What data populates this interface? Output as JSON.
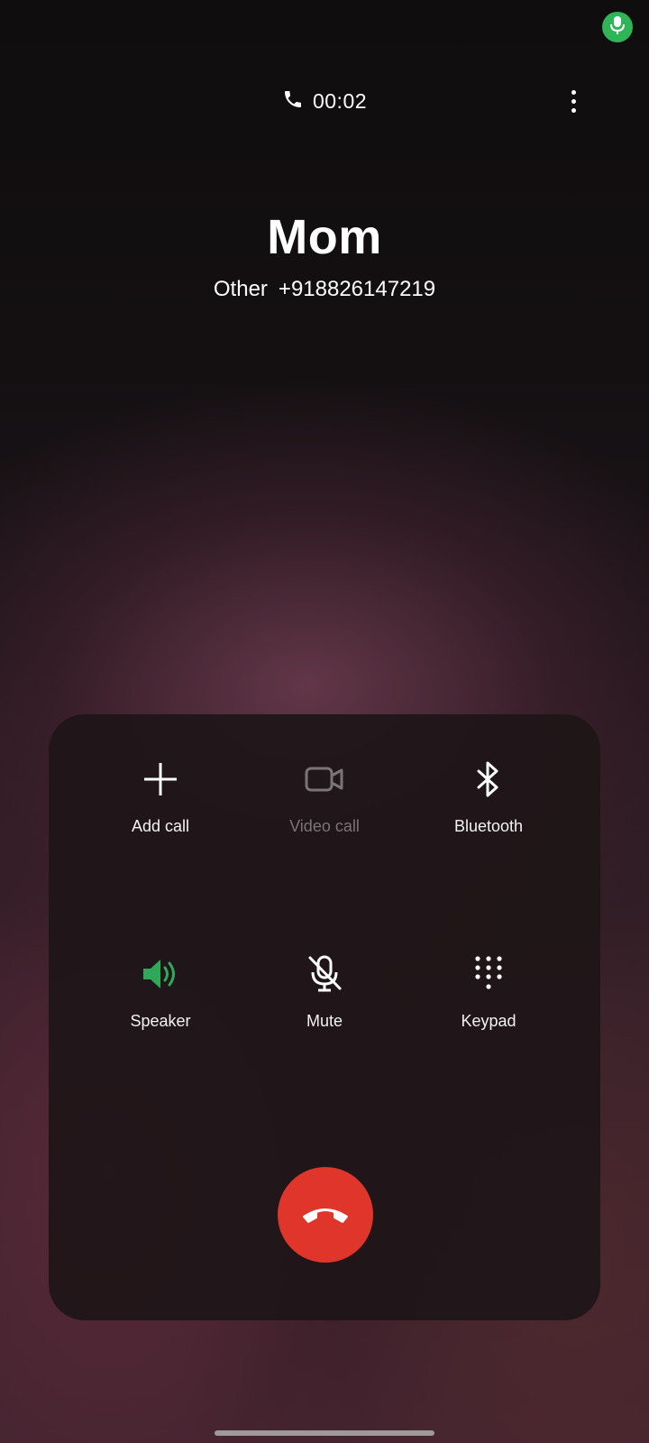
{
  "status_bar": {
    "mic_indicator_icon": "microphone-icon",
    "mic_indicator_color": "#2fb457"
  },
  "call_header": {
    "phone_icon": "phone-icon",
    "timer": "00:02",
    "more_icon": "more-vertical-icon"
  },
  "caller": {
    "name": "Mom",
    "number_label": "Other",
    "number": "+918826147219"
  },
  "controls": [
    {
      "id": "add-call",
      "label": "Add call",
      "icon": "plus-icon",
      "enabled": true
    },
    {
      "id": "video-call",
      "label": "Video call",
      "icon": "video-camera-icon",
      "enabled": false
    },
    {
      "id": "bluetooth",
      "label": "Bluetooth",
      "icon": "bluetooth-icon",
      "enabled": true
    },
    {
      "id": "speaker",
      "label": "Speaker",
      "icon": "speaker-icon",
      "enabled": true,
      "active": true
    },
    {
      "id": "mute",
      "label": "Mute",
      "icon": "mic-off-icon",
      "enabled": true
    },
    {
      "id": "keypad",
      "label": "Keypad",
      "icon": "keypad-icon",
      "enabled": true
    }
  ],
  "end_call": {
    "icon": "end-call-icon",
    "color": "#e0352b"
  },
  "colors": {
    "accent_active": "#2fa85a",
    "disabled": "#7a7476"
  }
}
